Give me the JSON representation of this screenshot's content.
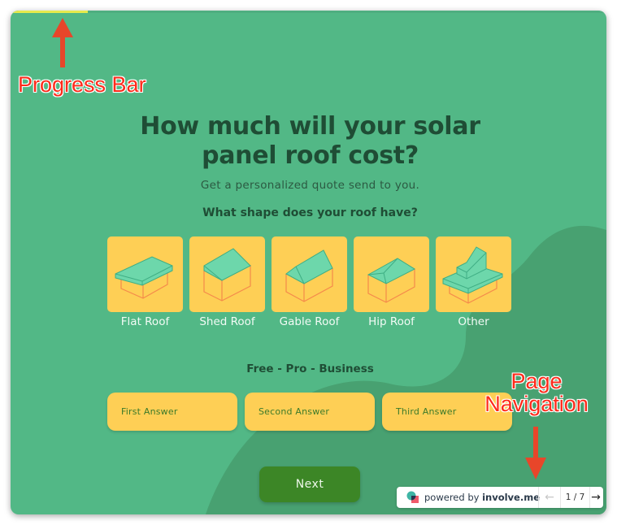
{
  "progress": {
    "value_percent": 13,
    "fill_color": "#e6ea4c"
  },
  "header": {
    "title_line1": "How much will your solar",
    "title_line2": "panel roof cost?",
    "subtitle": "Get a personalized quote send to you."
  },
  "roof_question": {
    "label": "What shape does your roof have?",
    "options": [
      {
        "label": "Flat Roof",
        "icon": "flat-roof-icon"
      },
      {
        "label": "Shed Roof",
        "icon": "shed-roof-icon"
      },
      {
        "label": "Gable Roof",
        "icon": "gable-roof-icon"
      },
      {
        "label": "Hip Roof",
        "icon": "hip-roof-icon"
      },
      {
        "label": "Other",
        "icon": "other-roof-icon"
      }
    ]
  },
  "plan_question": {
    "label": "Free - Pro - Business",
    "answers": [
      "First Answer",
      "Second Answer",
      "Third Answer"
    ]
  },
  "next_button": {
    "label": "Next"
  },
  "footer": {
    "powered_by": "powered by ",
    "brand": "involve.me",
    "prev_icon": "←",
    "page_indicator": "1 / 7",
    "next_icon": "→"
  },
  "annotations": {
    "progress_bar": "Progress Bar",
    "page_navigation_line1": "Page",
    "page_navigation_line2": "Navigation"
  },
  "colors": {
    "background": "#52b886",
    "card": "#fecf55",
    "title": "#1f4d35",
    "next_button": "#3c8626",
    "annotation": "#ff2a1a"
  }
}
